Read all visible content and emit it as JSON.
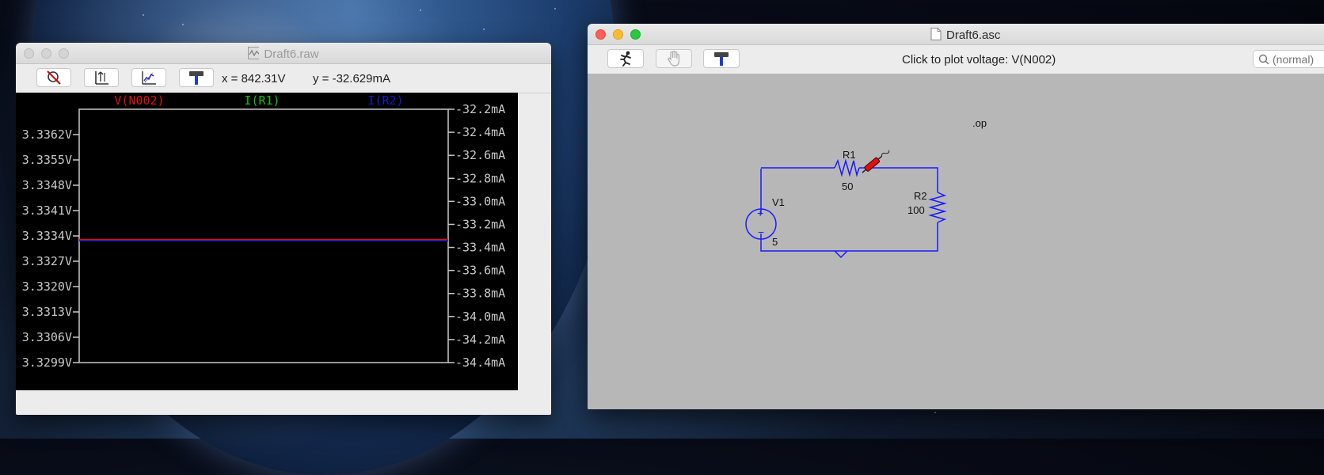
{
  "colors": {
    "trace_v": "#e01010",
    "trace_i_r1": "#10c010",
    "trace_i_r2": "#1818d0",
    "wire": "#1a1aff",
    "plot_bg": "#000000",
    "axis": "#c8c8c8",
    "schematic_bg": "#b7b7b7"
  },
  "waveform_window": {
    "title": "Draft6.raw",
    "toolbar_icons": [
      "zoom-cancel-icon",
      "autorange-icon",
      "zoom-full-icon",
      "hammer-icon"
    ],
    "cursor_x": "x = 842.31V",
    "cursor_y": "y = -32.629mA"
  },
  "chart_data": {
    "type": "line",
    "legend": [
      "V(N002)",
      "I(R1)",
      "I(R2)"
    ],
    "left_axis": {
      "ticks": [
        "3.3362V",
        "3.3355V",
        "3.3348V",
        "3.3341V",
        "3.3334V",
        "3.3327V",
        "3.3320V",
        "3.3313V",
        "3.3306V",
        "3.3299V"
      ],
      "ylim": [
        3.3299,
        3.3362
      ]
    },
    "right_axis": {
      "ticks": [
        "-32.2mA",
        "-32.4mA",
        "-32.6mA",
        "-32.8mA",
        "-33.0mA",
        "-33.2mA",
        "-33.4mA",
        "-33.6mA",
        "-33.8mA",
        "-34.0mA",
        "-34.2mA",
        "-34.4mA"
      ],
      "ylim": [
        -34.4,
        -32.2
      ]
    },
    "series": [
      {
        "name": "V(N002)",
        "axis": "left",
        "value": 3.3333
      },
      {
        "name": "I(R1)",
        "axis": "right",
        "value": -33.333
      },
      {
        "name": "I(R2)",
        "axis": "right",
        "value": -33.333
      }
    ],
    "grid": false
  },
  "schematic_window": {
    "title": "Draft6.asc",
    "toolbar_icons": [
      "run-icon",
      "hand-icon",
      "hammer-icon"
    ],
    "status": "Click to plot voltage: V(N002)",
    "search_placeholder": "(normal)",
    "directive": ".op",
    "components": {
      "r1": {
        "name": "R1",
        "value": "50"
      },
      "r2": {
        "name": "R2",
        "value": "100"
      },
      "v1": {
        "name": "V1",
        "value": "5"
      }
    },
    "probe_icon": "voltage-probe-icon"
  }
}
